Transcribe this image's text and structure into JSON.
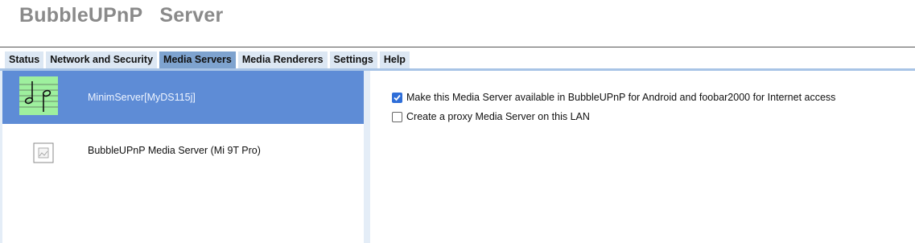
{
  "app": {
    "title": "BubbleUPnP   Server"
  },
  "tabs": [
    {
      "label": "Status",
      "active": false
    },
    {
      "label": "Network and Security",
      "active": false
    },
    {
      "label": "Media Servers",
      "active": true
    },
    {
      "label": "Media Renderers",
      "active": false
    },
    {
      "label": "Settings",
      "active": false
    },
    {
      "label": "Help",
      "active": false
    }
  ],
  "servers": [
    {
      "name": "MinimServer[MyDS115j]",
      "icon": "music-notes-icon",
      "selected": true
    },
    {
      "name": "BubbleUPnP Media Server (Mi 9T Pro)",
      "icon": "broken-image-icon",
      "selected": false
    }
  ],
  "options": {
    "internet_access": {
      "label": "Make this Media Server available in BubbleUPnP for Android and foobar2000 for Internet access",
      "checked": true
    },
    "proxy_lan": {
      "label": "Create a proxy Media Server on this LAN",
      "checked": false
    }
  },
  "colors": {
    "title": "#8a8a8a",
    "tab_bg": "#dce7f3",
    "tab_active": "#7ea3cf",
    "selected_row": "#5e8cd6",
    "checkbox_checked": "#2f6ed8",
    "icon_bg": "#9ef09e"
  }
}
